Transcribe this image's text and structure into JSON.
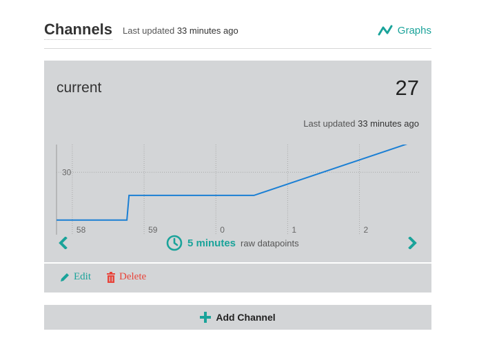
{
  "header": {
    "title": "Channels",
    "updated_prefix": "Last updated",
    "updated_value": "33 minutes ago",
    "graphs_label": "Graphs"
  },
  "channel": {
    "name": "current",
    "value": "27",
    "updated_prefix": "Last updated",
    "updated_value": "33 minutes ago",
    "range_value": "5 minutes",
    "range_desc": "raw datapoints",
    "edit_label": "Edit",
    "delete_label": "Delete"
  },
  "add_channel_label": "Add Channel",
  "colors": {
    "accent": "#1aa39a",
    "danger": "#e8443a",
    "line": "#1a7fd4",
    "card_bg": "#d3d5d7"
  },
  "chart_data": {
    "type": "line",
    "x_ticks": [
      {
        "label": "58",
        "value": -2
      },
      {
        "label": "59",
        "value": -1
      },
      {
        "label": "0",
        "value": 0
      },
      {
        "label": "1",
        "value": 1
      },
      {
        "label": "2",
        "value": 2
      }
    ],
    "y_ticks": [
      {
        "label": "30",
        "value": 30
      }
    ],
    "xlim": [
      -2.22,
      2.83
    ],
    "ylim": [
      21.9,
      33.6
    ],
    "grid": true,
    "series": [
      {
        "x": [
          -2.22,
          -1.24,
          -1.21,
          -0.5,
          0.53,
          2.83
        ],
        "y": [
          23.8,
          23.8,
          27.0,
          27.0,
          27.0,
          34.2
        ]
      }
    ]
  }
}
